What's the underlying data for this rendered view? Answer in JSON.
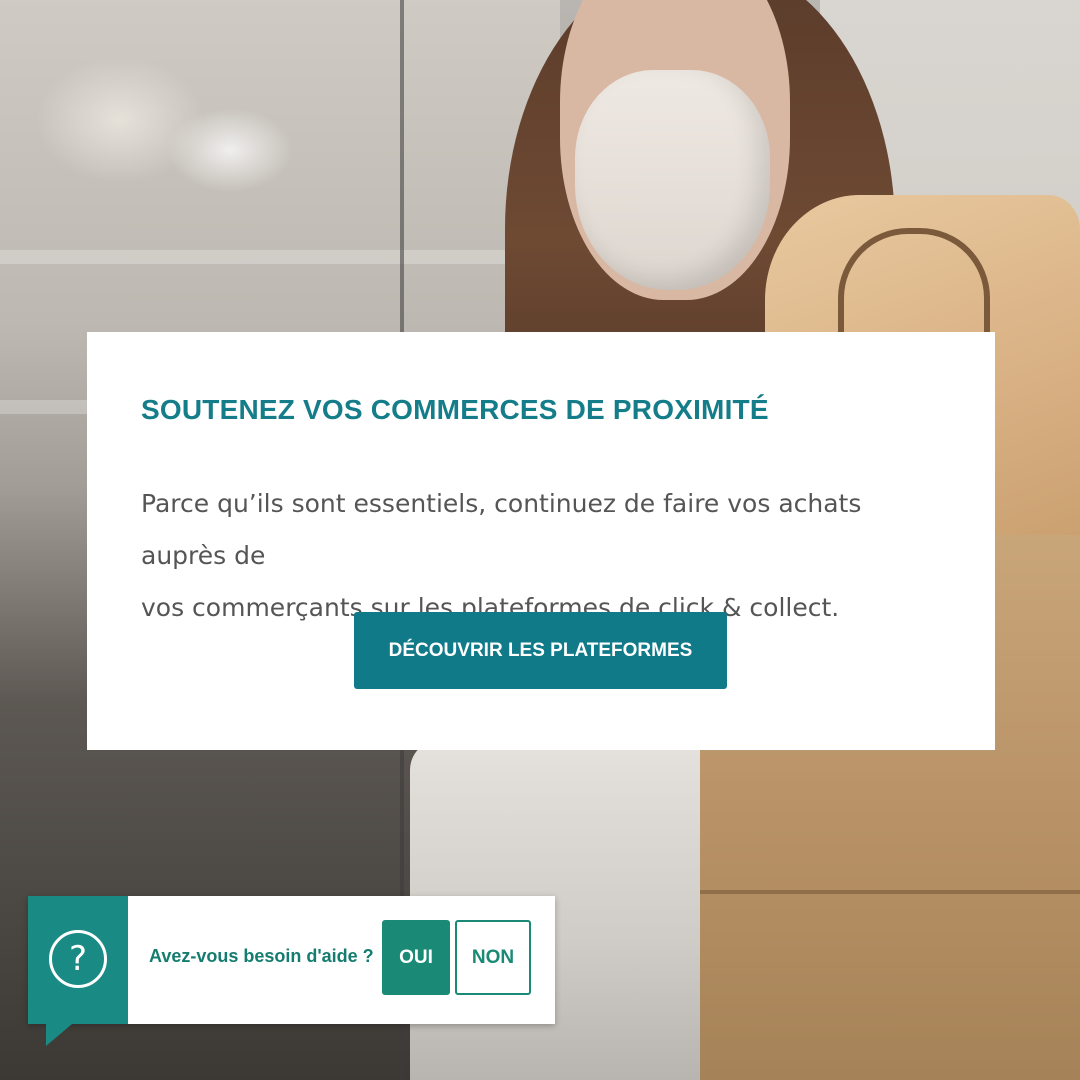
{
  "promo": {
    "title": "SOUTENEZ VOS COMMERCES DE PROXIMITÉ",
    "text_line1": "Parce qu’ils sont essentiels, continuez de faire vos achats auprès de",
    "text_line2": "vos commerçants sur les plateformes de click & collect.",
    "button_label": "DÉCOUVRIR LES PLATEFORMES"
  },
  "help_widget": {
    "icon": "question-mark-icon",
    "icon_glyph": "?",
    "question": "Avez-vous besoin d'aide ?",
    "yes_label": "OUI",
    "no_label": "NON"
  },
  "colors": {
    "accent": "#117a89",
    "help_green": "#1a8a76",
    "card_bg": "#ffffff"
  }
}
